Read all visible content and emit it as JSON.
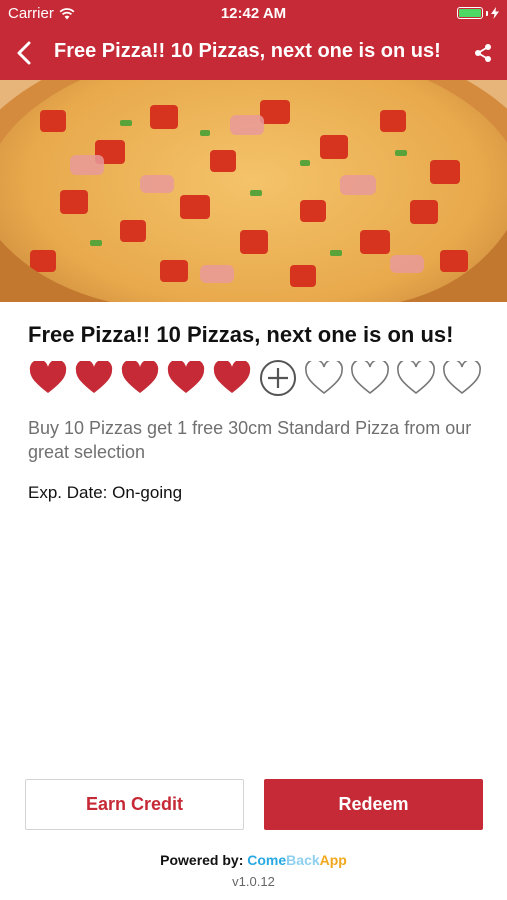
{
  "status_bar": {
    "carrier": "Carrier",
    "time": "12:42 AM",
    "battery_color": "#4cd964"
  },
  "nav": {
    "title": "Free Pizza!! 10 Pizzas, next one is on us!",
    "back_icon": "chevron-left-icon",
    "share_icon": "share-icon",
    "bar_color": "#c62a36"
  },
  "hero_image": {
    "subject": "pizza-photo"
  },
  "offer": {
    "title": "Free Pizza!! 10 Pizzas, next one is on us!",
    "stamps_total": 10,
    "stamps_earned": 5,
    "next_stamp_icon": "add-circle-icon",
    "earned_icon": "heart-filled-icon",
    "empty_icon": "heart-outline-icon",
    "description": "Buy 10 Pizzas get 1 free 30cm Standard Pizza from our great selection",
    "expiry": "Exp. Date: On-going"
  },
  "actions": {
    "earn_label": "Earn Credit",
    "redeem_label": "Redeem"
  },
  "footer": {
    "powered_label": "Powered by:",
    "brand_part1": "Come",
    "brand_part2": "Back",
    "brand_part3": "App",
    "version": "v1.0.12"
  }
}
